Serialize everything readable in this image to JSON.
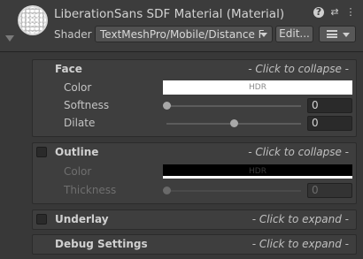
{
  "header": {
    "title": "LiberationSans SDF Material (Material)",
    "shader_label": "Shader",
    "shader_value": "TextMeshPro/Mobile/Distance F",
    "edit_label": "Edit...",
    "icons": [
      "help-icon",
      "preset-icon",
      "more-icon",
      "list-icon"
    ]
  },
  "face": {
    "title": "Face",
    "hint": "- Click to collapse -",
    "color_label": "Color",
    "color_value": "HDR",
    "color": "#ffffff",
    "softness_label": "Softness",
    "softness_value": "0",
    "softness_level": 0,
    "dilate_label": "Dilate",
    "dilate_value": "0",
    "dilate_level": 0.5
  },
  "outline": {
    "title": "Outline",
    "hint": "- Click to collapse -",
    "enabled": false,
    "color_label": "Color",
    "color_value": "HDR",
    "color": "#000000",
    "thickness_label": "Thickness",
    "thickness_value": "0",
    "thickness_level": 0
  },
  "underlay": {
    "title": "Underlay",
    "hint": "- Click to expand -",
    "enabled": false
  },
  "debug": {
    "title": "Debug Settings",
    "hint": "- Click to expand -"
  }
}
